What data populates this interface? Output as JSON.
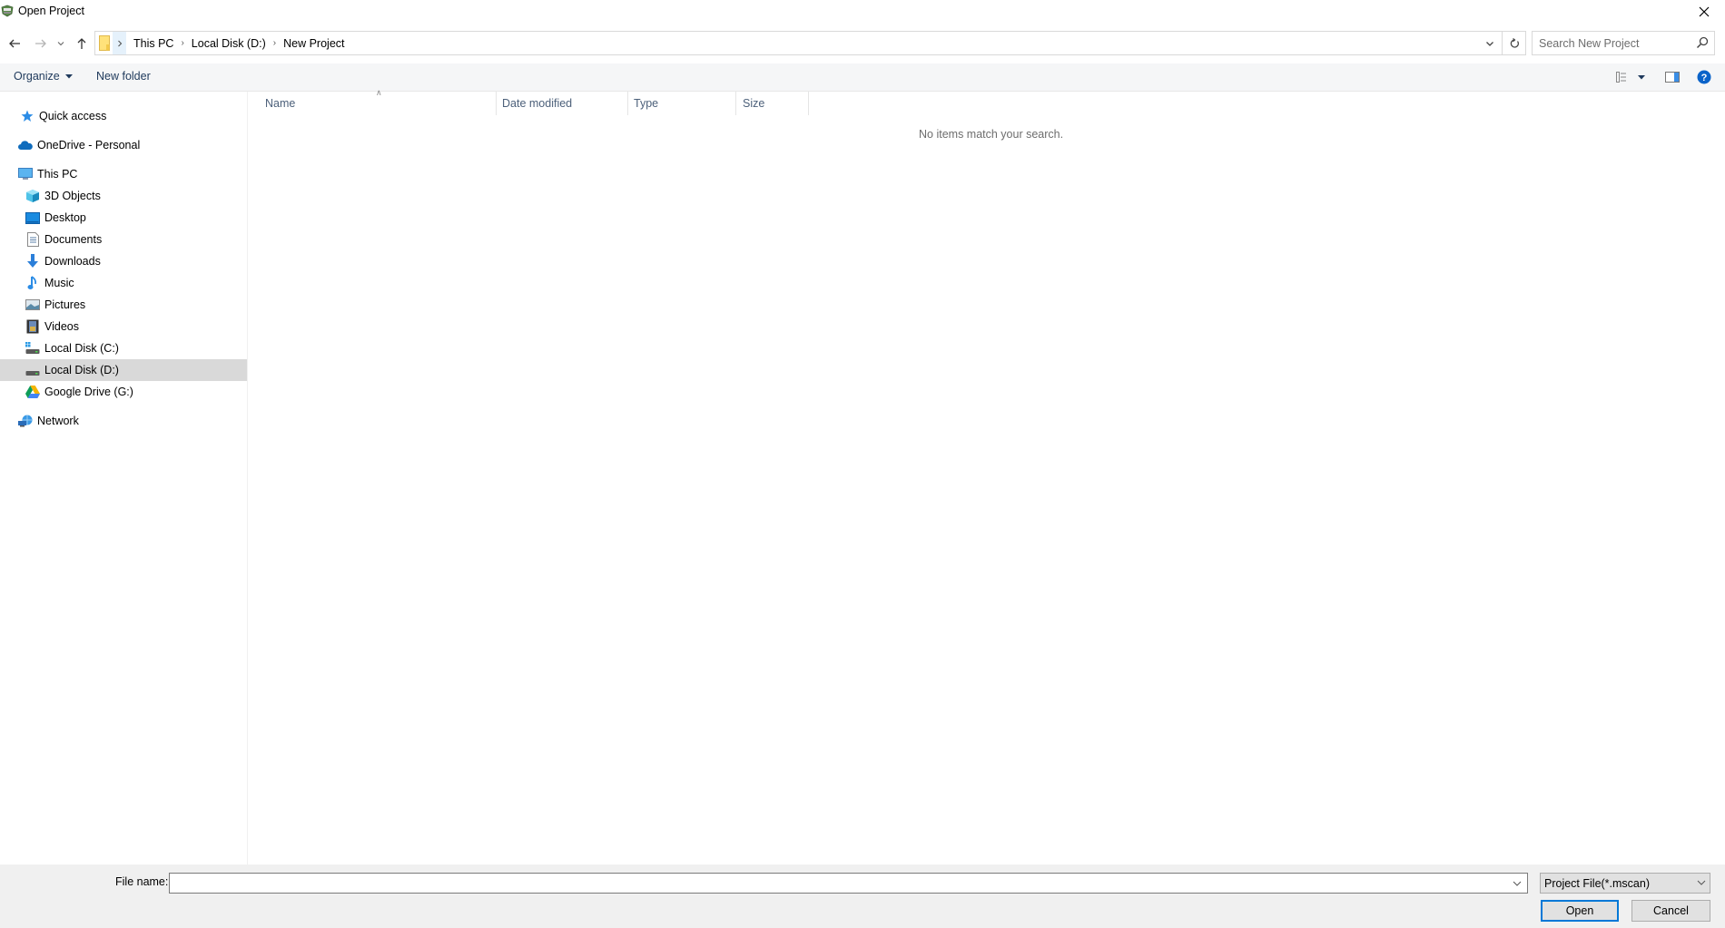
{
  "window": {
    "title": "Open Project",
    "app_icon": "scanner-app-icon",
    "close_icon": "close-icon"
  },
  "navigation": {
    "back_icon": "arrow-left-icon",
    "forward_icon": "arrow-right-icon",
    "recent_icon": "chevron-down-icon",
    "up_icon": "arrow-up-icon"
  },
  "address_bar": {
    "breadcrumbs": [
      "This PC",
      "Local Disk (D:)",
      "New Project"
    ],
    "dropdown_icon": "chevron-down-icon",
    "refresh_icon": "refresh-icon"
  },
  "search": {
    "placeholder": "Search New Project",
    "value": ""
  },
  "command_bar": {
    "organize_label": "Organize",
    "new_folder_label": "New folder",
    "view_icon": "details-view-icon",
    "preview_pane_icon": "preview-pane-icon",
    "help_icon": "help-icon"
  },
  "sidebar": {
    "items": [
      {
        "label": "Quick access",
        "icon": "star-icon",
        "level": 0,
        "selected": false
      },
      {
        "label": "OneDrive - Personal",
        "icon": "cloud-icon",
        "level": 0,
        "selected": false
      },
      {
        "label": "This PC",
        "icon": "computer-icon",
        "level": 0,
        "selected": false
      },
      {
        "label": "3D Objects",
        "icon": "cube-icon",
        "level": 1,
        "selected": false
      },
      {
        "label": "Desktop",
        "icon": "desktop-icon",
        "level": 1,
        "selected": false
      },
      {
        "label": "Documents",
        "icon": "document-icon",
        "level": 1,
        "selected": false
      },
      {
        "label": "Downloads",
        "icon": "download-icon",
        "level": 1,
        "selected": false
      },
      {
        "label": "Music",
        "icon": "music-icon",
        "level": 1,
        "selected": false
      },
      {
        "label": "Pictures",
        "icon": "pictures-icon",
        "level": 1,
        "selected": false
      },
      {
        "label": "Videos",
        "icon": "video-icon",
        "level": 1,
        "selected": false
      },
      {
        "label": "Local Disk (C:)",
        "icon": "system-drive-icon",
        "level": 1,
        "selected": false
      },
      {
        "label": "Local Disk (D:)",
        "icon": "drive-icon",
        "level": 1,
        "selected": true
      },
      {
        "label": "Google Drive (G:)",
        "icon": "google-drive-icon",
        "level": 1,
        "selected": false
      },
      {
        "label": "Network",
        "icon": "network-icon",
        "level": 0,
        "selected": false
      }
    ]
  },
  "file_list": {
    "columns": [
      "Name",
      "Date modified",
      "Type",
      "Size"
    ],
    "sorted_by": "Name",
    "empty_message": "No items match your search."
  },
  "footer": {
    "file_name_label": "File name:",
    "file_name_value": "",
    "file_type_selected": "Project File(*.mscan)",
    "open_label": "Open",
    "cancel_label": "Cancel"
  }
}
